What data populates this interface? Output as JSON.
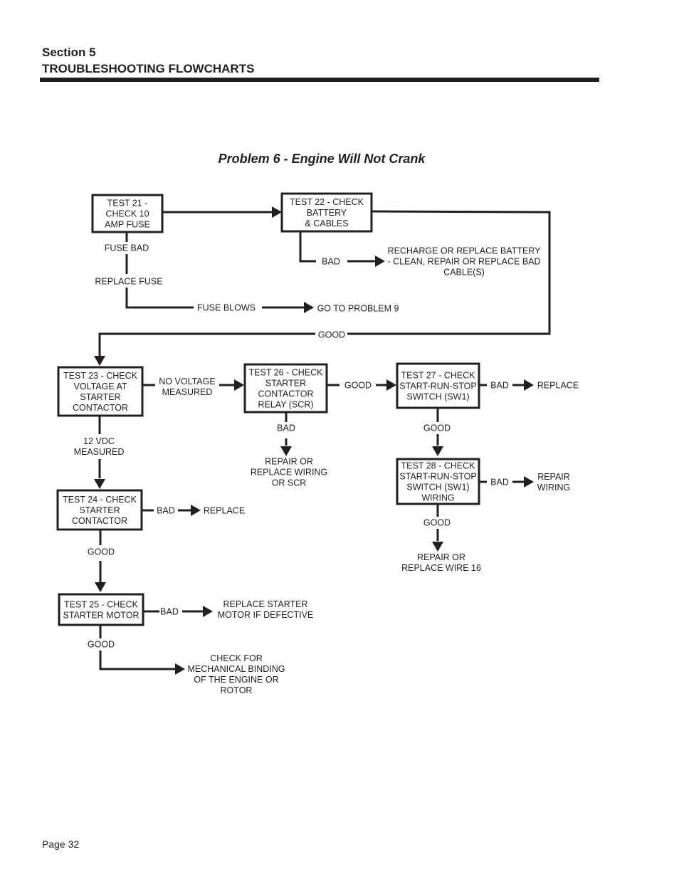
{
  "header": {
    "section": "Section 5",
    "title": "TROUBLESHOOTING FLOWCHARTS"
  },
  "chart_title": "Problem 6 -  Engine Will Not Crank",
  "footer": {
    "page": "Page 32"
  },
  "nodes": {
    "test21": [
      "TEST 21 -",
      "CHECK 10",
      "AMP FUSE"
    ],
    "test22": [
      "TEST 22 - CHECK",
      "BATTERY",
      "& CABLES"
    ],
    "test23": [
      "TEST 23 - CHECK",
      "VOLTAGE AT",
      "STARTER",
      "CONTACTOR"
    ],
    "test24": [
      "TEST 24 - CHECK",
      "STARTER",
      "CONTACTOR"
    ],
    "test25": [
      "TEST 25 - CHECK",
      "STARTER MOTOR"
    ],
    "test26": [
      "TEST 26 - CHECK",
      "STARTER",
      "CONTACTOR",
      "RELAY (SCR)"
    ],
    "test27": [
      "TEST 27 - CHECK",
      "START-RUN-STOP",
      "SWITCH (SW1)"
    ],
    "test28": [
      "TEST 28 - CHECK",
      "START-RUN-STOP",
      "SWITCH (SW1)",
      "WIRING"
    ]
  },
  "outcomes": {
    "recharge_battery": [
      "RECHARGE OR REPLACE BATTERY",
      "- CLEAN, REPAIR OR REPLACE BAD",
      "CABLE(S)"
    ],
    "go_to_problem9": [
      "GO TO PROBLEM 9"
    ],
    "repair_wiring_scr": [
      "REPAIR OR",
      "REPLACE WIRING",
      "OR SCR"
    ],
    "replace_sw1": [
      "REPLACE"
    ],
    "repair_wiring_sw1": [
      "REPAIR",
      "WIRING"
    ],
    "repair_wire16": [
      "REPAIR OR",
      "REPLACE WIRE 16"
    ],
    "replace_contactor": [
      "REPLACE"
    ],
    "replace_starter": [
      "REPLACE STARTER",
      "MOTOR IF DEFECTIVE"
    ],
    "check_binding": [
      "CHECK FOR",
      "MECHANICAL BINDING",
      "OF THE ENGINE OR",
      "ROTOR"
    ]
  },
  "labels": {
    "fuse_bad": [
      "FUSE BAD"
    ],
    "replace_fuse": [
      "REPLACE FUSE"
    ],
    "fuse_blows": [
      "FUSE BLOWS"
    ],
    "t22_bad": [
      "BAD"
    ],
    "t22_good": [
      "GOOD"
    ],
    "no_voltage": [
      "NO VOLTAGE",
      "MEASURED"
    ],
    "vdc12": [
      "12 VDC",
      "MEASURED"
    ],
    "t26_good": [
      "GOOD"
    ],
    "t26_bad": [
      "BAD"
    ],
    "t27_bad": [
      "BAD"
    ],
    "t27_good": [
      "GOOD"
    ],
    "t28_bad": [
      "BAD"
    ],
    "t28_good": [
      "GOOD"
    ],
    "t24_bad": [
      "BAD"
    ],
    "t24_good": [
      "GOOD"
    ],
    "t25_bad": [
      "BAD"
    ],
    "t25_good": [
      "GOOD"
    ]
  }
}
